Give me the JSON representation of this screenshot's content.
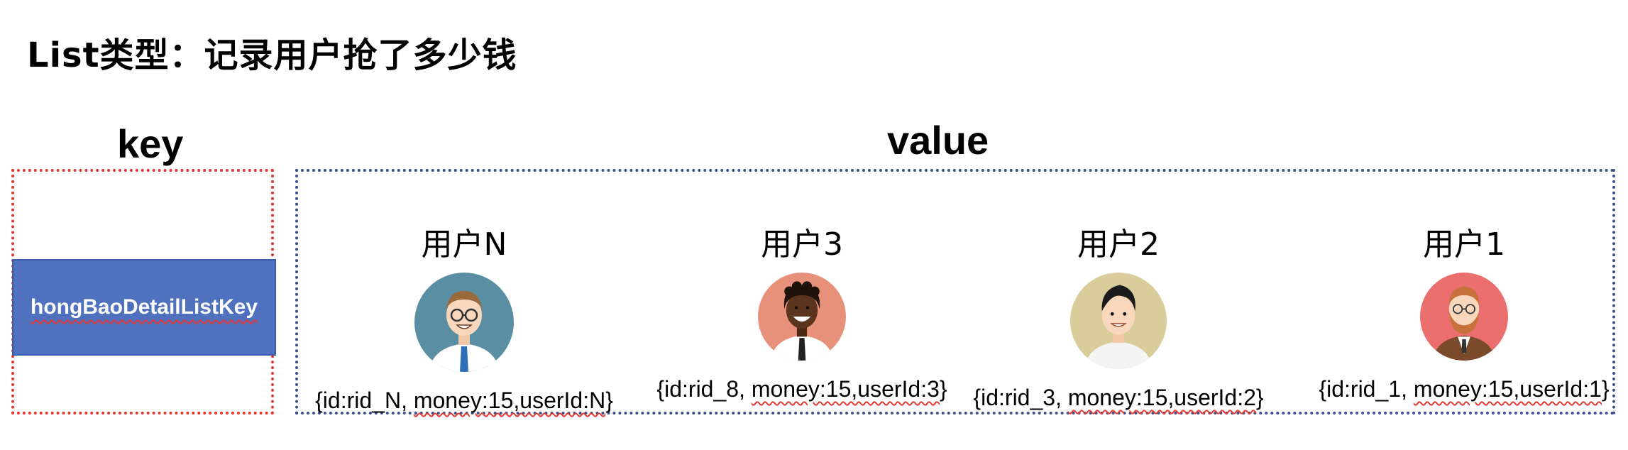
{
  "title": "List类型：记录用户抢了多少钱",
  "key_label": "key",
  "value_label": "value",
  "key_name": "hongBaoDetailListKey",
  "users": [
    {
      "name": "用户N",
      "id_part": "{id:rid_N, ",
      "money_part": "money:15,userId:N",
      "end": "}"
    },
    {
      "name": "用户3",
      "id_part": "{id:rid_8, ",
      "money_part": "money:15,userId:3",
      "end": "}"
    },
    {
      "name": "用户2",
      "id_part": "{id:rid_3, ",
      "money_part": "money:15,userId:2",
      "end": "}"
    },
    {
      "name": "用户1",
      "id_part": "{id:rid_1, ",
      "money_part": "money:15,userId:1",
      "end": "}"
    }
  ],
  "colors": {
    "key_border": "#e0352b",
    "value_border": "#3b4f8a",
    "key_fill": "#4f71be",
    "avatar_bg": [
      "#5a8fa3",
      "#e8917a",
      "#d8cd9b",
      "#ec6f6f"
    ]
  },
  "icons": [
    "avatar-man-glasses",
    "avatar-man-curly",
    "avatar-man-black-hair",
    "avatar-man-beard"
  ]
}
